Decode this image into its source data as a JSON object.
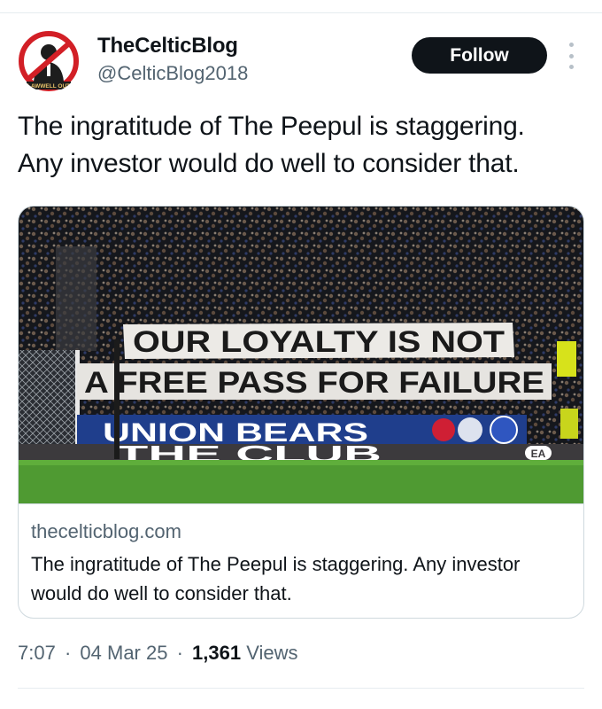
{
  "author": {
    "display_name": "TheCelticBlog",
    "handle": "@CelticBlog2018",
    "avatar_ribbon_text": "LAWWELL OUT"
  },
  "actions": {
    "follow_label": "Follow",
    "more_icon": "more-vertical-icon"
  },
  "tweet": {
    "text_line1": "The ingratitude of The Peepul is staggering.",
    "text_line2": "Any investor would do well to consider that."
  },
  "card": {
    "banner_top": "OUR LOYALTY IS NOT",
    "banner_bottom": "A FREE PASS FOR FAILURE",
    "hoarding_text": "UNION BEARS",
    "board_text": "THE CLUB",
    "board_logo": "EA",
    "domain": "thecelticblog.com",
    "title": "The ingratitude of The Peepul is staggering. Any investor would do well to consider that."
  },
  "meta": {
    "time": "7:07",
    "date": "04 Mar 25",
    "views_count": "1,361",
    "views_label": "Views",
    "separator": "·"
  },
  "colors": {
    "text": "#0f1419",
    "secondary": "#536471",
    "border": "#cfd9de",
    "follow_bg": "#0f1419",
    "pitch": "#4f9a32",
    "hoarding": "#1f3e8c"
  }
}
